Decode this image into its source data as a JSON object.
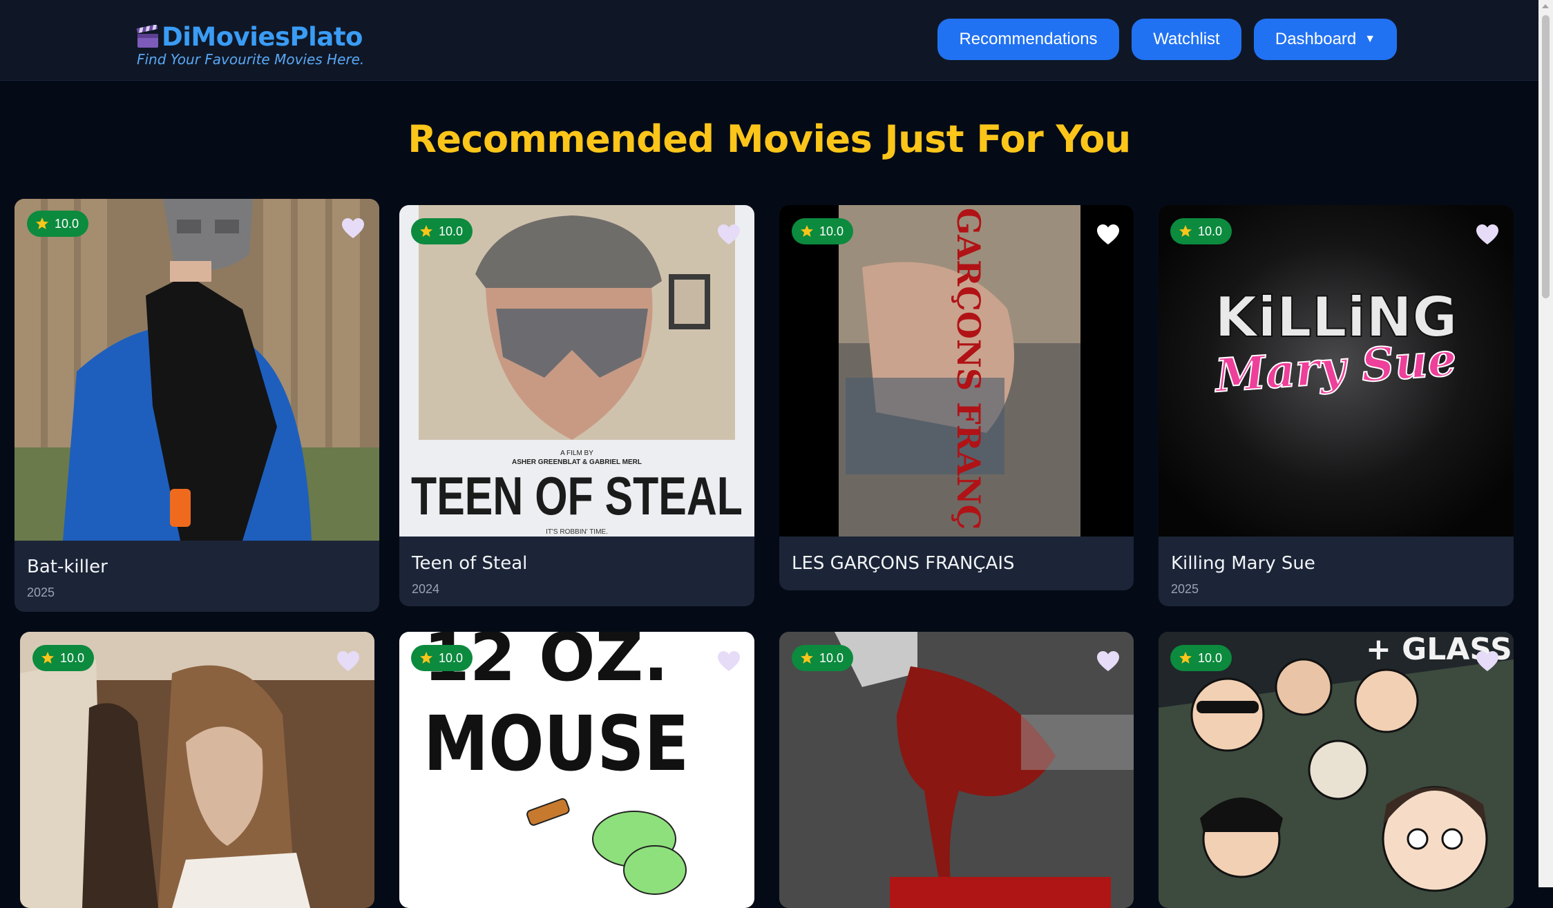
{
  "brand": {
    "name": "DiMoviesPlato",
    "tagline": "Find Your Favourite Movies Here."
  },
  "nav": {
    "recommendations": "Recommendations",
    "watchlist": "Watchlist",
    "dashboard": "Dashboard",
    "dashboard_caret": "▼"
  },
  "page": {
    "title": "Recommended Movies Just For You"
  },
  "movies": [
    {
      "title": "Bat-killer",
      "year": "2025",
      "rating": "10.0"
    },
    {
      "title": "Teen of Steal",
      "year": "2024",
      "rating": "10.0",
      "poster_text": {
        "credit_prefix": "A FILM BY",
        "credit_names": "ASHER GREENBLAT & GABRIEL MERL",
        "big": "TEEN OF STEAL",
        "tagline": "IT'S ROBBIN' TIME."
      }
    },
    {
      "title": "LES GARÇONS FRANÇAIS",
      "year": "",
      "rating": "10.0",
      "poster_text": {
        "vertical": "GARÇONS FRANÇ"
      }
    },
    {
      "title": "Killing Mary Sue",
      "year": "2025",
      "rating": "10.0",
      "poster_text": {
        "line1": "KiLLiNG",
        "line2": "Mary Sue"
      }
    },
    {
      "title": "",
      "year": "",
      "rating": "10.0"
    },
    {
      "title": "",
      "year": "",
      "rating": "10.0",
      "poster_text": {
        "line1": "12 OZ.",
        "line2": "MOUSE"
      }
    },
    {
      "title": "",
      "year": "",
      "rating": "10.0"
    },
    {
      "title": "",
      "year": "",
      "rating": "10.0",
      "poster_text": {
        "top": "+ GLASS"
      }
    }
  ],
  "colors": {
    "background": "#050b16",
    "navbar": "#0f1726",
    "accent_button": "#2172f2",
    "brand": "#3a9cf5",
    "heading": "#fbc51a",
    "rating_badge": "#0c8a3e",
    "card": "#1c2537"
  },
  "icons": {
    "logo": "clapperboard-icon",
    "rating": "star-icon",
    "favorite": "heart-icon"
  }
}
